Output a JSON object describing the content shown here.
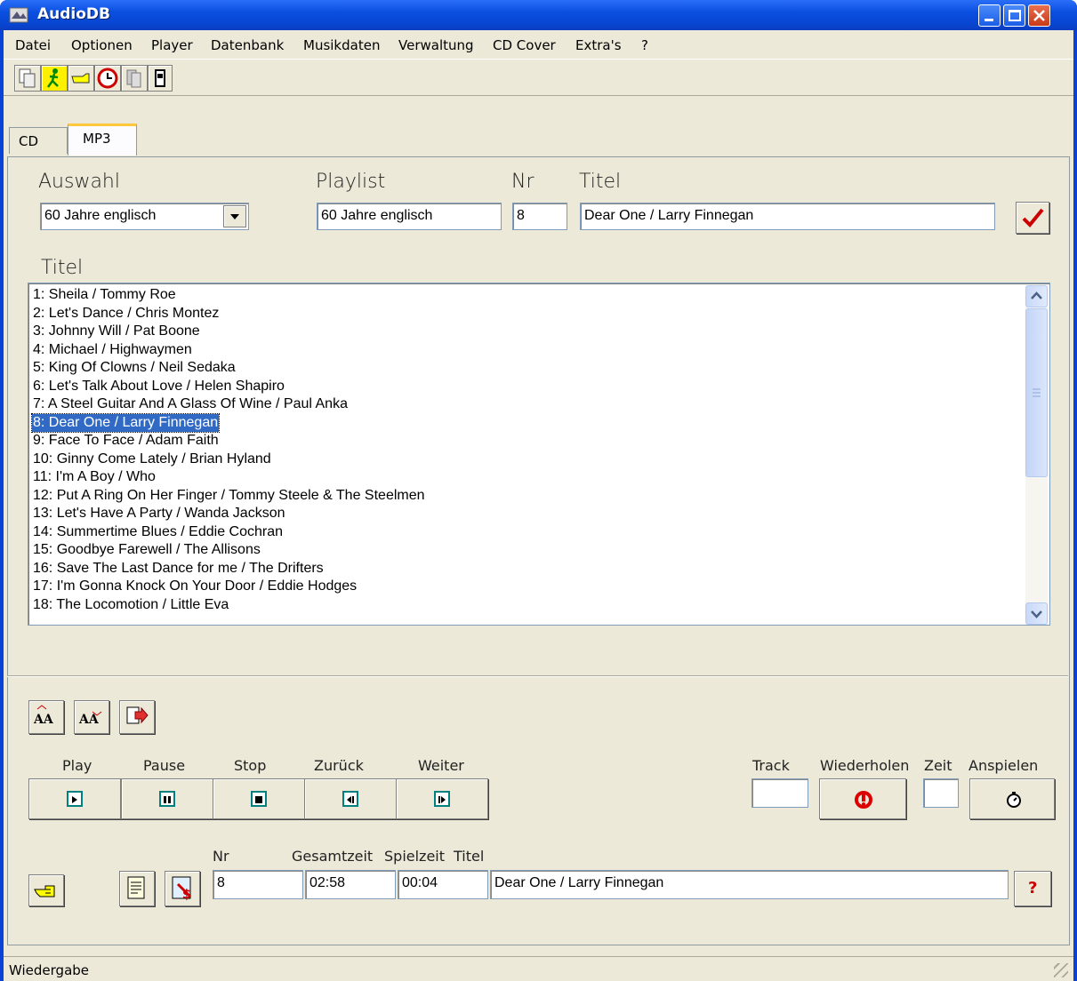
{
  "window": {
    "title": "AudioDB"
  },
  "menu": [
    "Datei",
    "Optionen",
    "Player",
    "Datenbank",
    "Musikdaten",
    "Verwaltung",
    "CD Cover",
    "Extra's",
    "?"
  ],
  "menu_underline": [
    "D",
    "O",
    "P",
    "D",
    "M",
    "V",
    "C",
    "E",
    "?"
  ],
  "toolbar": {
    "icons": [
      "copy-icon",
      "run-icon",
      "pointer-icon",
      "clock-icon",
      "pages-icon",
      "device-icon"
    ]
  },
  "tabs": [
    "CD",
    "MP3"
  ],
  "form": {
    "auswahl_label": "Auswahl",
    "auswahl_value": "60 Jahre englisch",
    "playlist_label": "Playlist",
    "playlist_value": "60 Jahre englisch",
    "nr_label": "Nr",
    "nr_value": "8",
    "titel_label": "Titel",
    "titel_value": "Dear One / Larry Finnegan"
  },
  "list": {
    "label": "Titel",
    "items": [
      "1: Sheila / Tommy Roe",
      "2: Let's Dance / Chris Montez",
      "3: Johnny Will / Pat Boone",
      "4: Michael / Highwaymen",
      "5: King Of Clowns / Neil Sedaka",
      "6: Let's Talk About Love / Helen Shapiro",
      "7: A Steel Guitar And A Glass Of Wine / Paul Anka",
      "8: Dear One / Larry Finnegan",
      "9: Face To Face / Adam Faith",
      "10: Ginny Come Lately / Brian Hyland",
      "11: I'm A Boy / Who",
      "12: Put A Ring On Her Finger / Tommy Steele & The Steelmen",
      "13: Let's Have A Party / Wanda Jackson",
      "14: Summertime Blues / Eddie Cochran",
      "15: Goodbye Farewell / The Allisons",
      "16: Save The Last Dance for me / The Drifters",
      "17: I'm Gonna Knock On Your Door / Eddie Hodges",
      "18: The Locomotion / Little Eva"
    ],
    "selected_index": 7
  },
  "player": {
    "play": "Play",
    "pause": "Pause",
    "stop": "Stop",
    "back": "Zurück",
    "next": "Weiter",
    "track": "Track",
    "repeat": "Wiederholen",
    "zeit": "Zeit",
    "anspielen": "Anspielen"
  },
  "now_playing": {
    "nr_label": "Nr",
    "gesamt_label": "Gesamtzeit",
    "spiel_label": "Spielzeit",
    "titel_label": "Titel",
    "nr": "8",
    "gesamt": "02:58",
    "spiel": "00:04",
    "titel": "Dear One / Larry Finnegan"
  },
  "status": "Wiedergabe"
}
